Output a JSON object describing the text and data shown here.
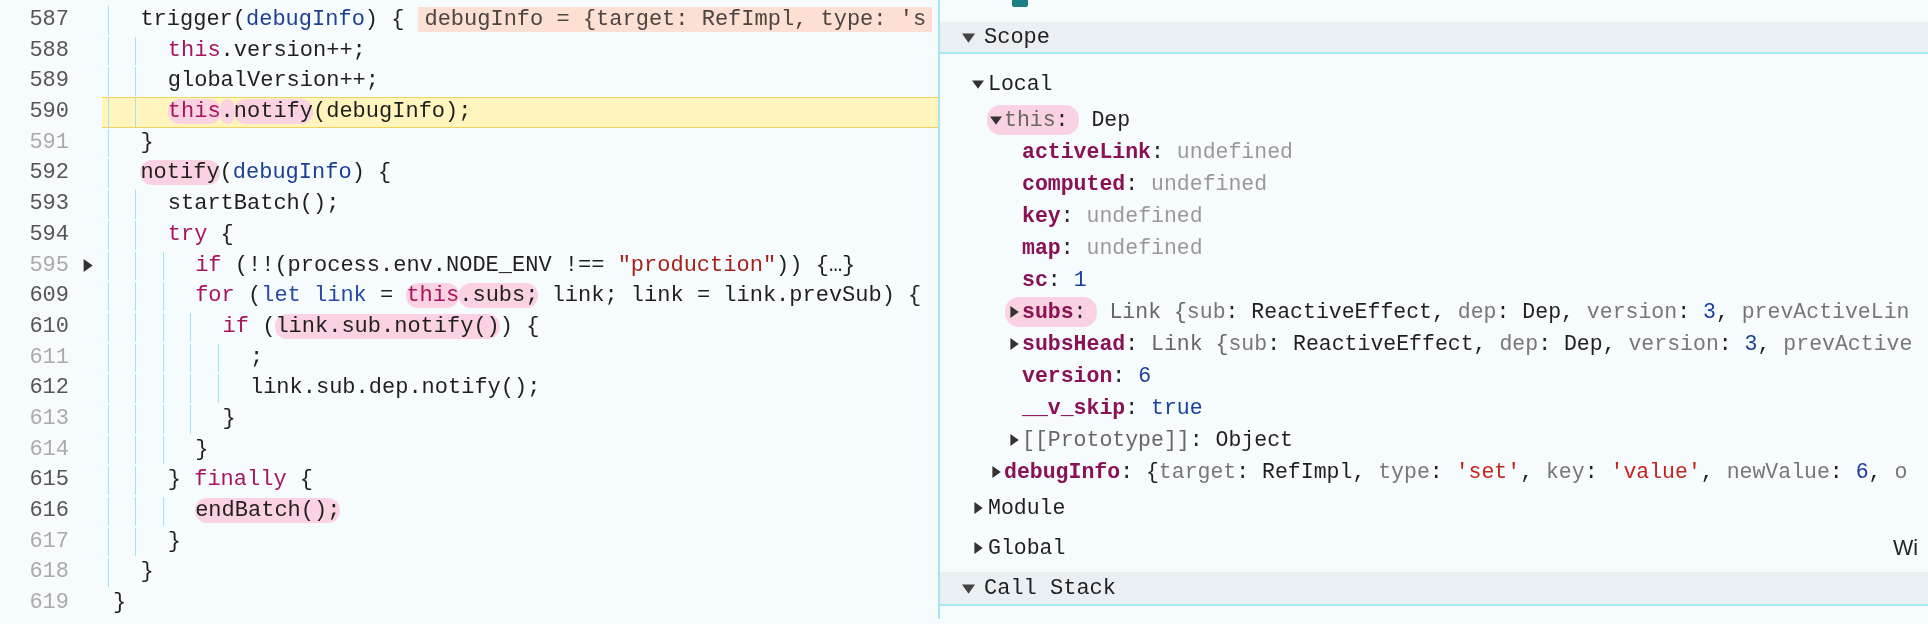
{
  "editor": {
    "lines": [
      {
        "number": "587",
        "breakable": true,
        "current": false,
        "foldable": false,
        "tokens": [
          {
            "text": "  trigger(",
            "kind": "plain",
            "annotated": false
          },
          {
            "text": "debugInfo",
            "kind": "param",
            "annotated": false
          },
          {
            "text": ") {",
            "kind": "plain",
            "annotated": false
          }
        ],
        "inline_value": "debugInfo = {target: RefImpl, type: 's"
      },
      {
        "number": "588",
        "breakable": true,
        "current": false,
        "foldable": false,
        "tokens": [
          {
            "text": "    this",
            "kind": "keyword",
            "annotated": false
          },
          {
            "text": ".version++;",
            "kind": "plain",
            "annotated": false
          }
        ]
      },
      {
        "number": "589",
        "breakable": true,
        "current": false,
        "foldable": false,
        "tokens": [
          {
            "text": "    globalVersion++;",
            "kind": "plain",
            "annotated": false
          }
        ]
      },
      {
        "number": "590",
        "breakable": true,
        "current": true,
        "foldable": false,
        "tokens": [
          {
            "text": "    this",
            "kind": "keyword",
            "annotated": true
          },
          {
            "text": ".",
            "kind": "plain",
            "annotated": true
          },
          {
            "text": "notify",
            "kind": "selection",
            "annotated": true
          },
          {
            "text": "(debugInfo);",
            "kind": "plain",
            "annotated": false
          }
        ]
      },
      {
        "number": "591",
        "breakable": false,
        "current": false,
        "foldable": false,
        "tokens": [
          {
            "text": "  }",
            "kind": "plain",
            "annotated": false
          }
        ]
      },
      {
        "number": "592",
        "breakable": true,
        "current": false,
        "foldable": false,
        "tokens": [
          {
            "text": "  notify",
            "kind": "plain",
            "annotated": true
          },
          {
            "text": "(",
            "kind": "plain",
            "annotated": false
          },
          {
            "text": "debugInfo",
            "kind": "param",
            "annotated": false
          },
          {
            "text": ") {",
            "kind": "plain",
            "annotated": false
          }
        ]
      },
      {
        "number": "593",
        "breakable": true,
        "current": false,
        "foldable": false,
        "tokens": [
          {
            "text": "    startBatch();",
            "kind": "plain",
            "annotated": false
          }
        ]
      },
      {
        "number": "594",
        "breakable": true,
        "current": false,
        "foldable": false,
        "tokens": [
          {
            "text": "    try",
            "kind": "keyword",
            "annotated": false
          },
          {
            "text": " {",
            "kind": "plain",
            "annotated": false
          }
        ]
      },
      {
        "number": "595",
        "breakable": false,
        "current": false,
        "foldable": true,
        "tokens": [
          {
            "text": "      if",
            "kind": "keyword",
            "annotated": false
          },
          {
            "text": " (!!(process.env.NODE_ENV !== ",
            "kind": "plain",
            "annotated": false
          },
          {
            "text": "\"production\"",
            "kind": "string",
            "annotated": false
          },
          {
            "text": ")) {…}",
            "kind": "plain",
            "annotated": false
          }
        ]
      },
      {
        "number": "609",
        "breakable": true,
        "current": false,
        "foldable": false,
        "tokens": [
          {
            "text": "      for",
            "kind": "keyword",
            "annotated": false
          },
          {
            "text": " (",
            "kind": "plain",
            "annotated": false
          },
          {
            "text": "let link",
            "kind": "declaration",
            "annotated": false
          },
          {
            "text": " = ",
            "kind": "plain",
            "annotated": false
          },
          {
            "text": "this",
            "kind": "keyword",
            "annotated": true
          },
          {
            "text": ".subs;",
            "kind": "plain",
            "annotated": true
          },
          {
            "text": " link; link = link.prevSub) {",
            "kind": "plain",
            "annotated": false
          }
        ]
      },
      {
        "number": "610",
        "breakable": true,
        "current": false,
        "foldable": false,
        "tokens": [
          {
            "text": "        if",
            "kind": "keyword",
            "annotated": false
          },
          {
            "text": " (",
            "kind": "plain",
            "annotated": false
          },
          {
            "text": "link.sub.notify()",
            "kind": "plain",
            "annotated": true
          },
          {
            "text": ") {",
            "kind": "plain",
            "annotated": false
          }
        ]
      },
      {
        "number": "611",
        "breakable": false,
        "current": false,
        "foldable": false,
        "tokens": [
          {
            "text": "          ;",
            "kind": "plain",
            "annotated": false
          }
        ]
      },
      {
        "number": "612",
        "breakable": true,
        "current": false,
        "foldable": false,
        "tokens": [
          {
            "text": "          link.sub.dep.notify();",
            "kind": "plain",
            "annotated": false
          }
        ]
      },
      {
        "number": "613",
        "breakable": false,
        "current": false,
        "foldable": false,
        "tokens": [
          {
            "text": "        }",
            "kind": "plain",
            "annotated": false
          }
        ]
      },
      {
        "number": "614",
        "breakable": false,
        "current": false,
        "foldable": false,
        "tokens": [
          {
            "text": "      }",
            "kind": "plain",
            "annotated": false
          }
        ]
      },
      {
        "number": "615",
        "breakable": true,
        "current": false,
        "foldable": false,
        "tokens": [
          {
            "text": "    } ",
            "kind": "plain",
            "annotated": false
          },
          {
            "text": "finally",
            "kind": "keyword",
            "annotated": false
          },
          {
            "text": " {",
            "kind": "plain",
            "annotated": false
          }
        ]
      },
      {
        "number": "616",
        "breakable": true,
        "current": false,
        "foldable": false,
        "tokens": [
          {
            "text": "      endBatch();",
            "kind": "plain",
            "annotated": true
          }
        ]
      },
      {
        "number": "617",
        "breakable": false,
        "current": false,
        "foldable": false,
        "tokens": [
          {
            "text": "    }",
            "kind": "plain",
            "annotated": false
          }
        ]
      },
      {
        "number": "618",
        "breakable": false,
        "current": false,
        "foldable": false,
        "tokens": [
          {
            "text": "  }",
            "kind": "plain",
            "annotated": false
          }
        ]
      },
      {
        "number": "619",
        "breakable": false,
        "current": false,
        "foldable": false,
        "tokens": [
          {
            "text": "}",
            "kind": "plain",
            "annotated": false
          }
        ]
      }
    ]
  },
  "scope": {
    "title": "Scope",
    "expanded": true,
    "items": [
      {
        "name": "Local",
        "kind": "scope",
        "expandable": true,
        "expanded": true,
        "marked": false,
        "children": [
          {
            "name": "this:",
            "kind": "dim",
            "expandable": true,
            "expanded": true,
            "marked": true,
            "value": [
              {
                "text": "Dep",
                "kind": "plain"
              }
            ],
            "children": [
              {
                "name": "activeLink:",
                "kind": "property",
                "expandable": false,
                "marked": false,
                "value": [
                  {
                    "text": "undefined",
                    "kind": "undefined"
                  }
                ]
              },
              {
                "name": "computed:",
                "kind": "property",
                "expandable": false,
                "marked": false,
                "value": [
                  {
                    "text": "undefined",
                    "kind": "undefined"
                  }
                ]
              },
              {
                "name": "key:",
                "kind": "property",
                "expandable": false,
                "marked": false,
                "value": [
                  {
                    "text": "undefined",
                    "kind": "undefined"
                  }
                ]
              },
              {
                "name": "map:",
                "kind": "property",
                "expandable": false,
                "marked": false,
                "value": [
                  {
                    "text": "undefined",
                    "kind": "undefined"
                  }
                ]
              },
              {
                "name": "sc:",
                "kind": "property",
                "expandable": false,
                "marked": false,
                "value": [
                  {
                    "text": "1",
                    "kind": "number"
                  }
                ]
              },
              {
                "name": "subs:",
                "kind": "property",
                "expandable": true,
                "expanded": false,
                "marked": true,
                "value": [
                  {
                    "text": "Link {",
                    "kind": "dim"
                  },
                  {
                    "text": "sub",
                    "kind": "key"
                  },
                  {
                    "text": ": ReactiveEffect, ",
                    "kind": "plain"
                  },
                  {
                    "text": "dep",
                    "kind": "key"
                  },
                  {
                    "text": ": Dep, ",
                    "kind": "plain"
                  },
                  {
                    "text": "version",
                    "kind": "key"
                  },
                  {
                    "text": ": ",
                    "kind": "plain"
                  },
                  {
                    "text": "3",
                    "kind": "number"
                  },
                  {
                    "text": ", ",
                    "kind": "plain"
                  },
                  {
                    "text": "prevActiveLin",
                    "kind": "key"
                  }
                ]
              },
              {
                "name": "subsHead:",
                "kind": "property",
                "expandable": true,
                "expanded": false,
                "marked": false,
                "value": [
                  {
                    "text": "Link {",
                    "kind": "dim"
                  },
                  {
                    "text": "sub",
                    "kind": "key"
                  },
                  {
                    "text": ": ReactiveEffect, ",
                    "kind": "plain"
                  },
                  {
                    "text": "dep",
                    "kind": "key"
                  },
                  {
                    "text": ": Dep, ",
                    "kind": "plain"
                  },
                  {
                    "text": "version",
                    "kind": "key"
                  },
                  {
                    "text": ": ",
                    "kind": "plain"
                  },
                  {
                    "text": "3",
                    "kind": "number"
                  },
                  {
                    "text": ", ",
                    "kind": "plain"
                  },
                  {
                    "text": "prevActive",
                    "kind": "key"
                  }
                ]
              },
              {
                "name": "version:",
                "kind": "property",
                "expandable": false,
                "marked": false,
                "value": [
                  {
                    "text": "6",
                    "kind": "number"
                  }
                ]
              },
              {
                "name": "__v_skip:",
                "kind": "property",
                "expandable": false,
                "marked": false,
                "value": [
                  {
                    "text": "true",
                    "kind": "number"
                  }
                ]
              },
              {
                "name": "[[Prototype]]:",
                "kind": "dim",
                "expandable": true,
                "expanded": false,
                "marked": false,
                "value": [
                  {
                    "text": "Object",
                    "kind": "plain"
                  }
                ]
              }
            ]
          },
          {
            "name": "debugInfo:",
            "kind": "property",
            "expandable": true,
            "expanded": false,
            "marked": false,
            "value": [
              {
                "text": "{",
                "kind": "plain"
              },
              {
                "text": "target",
                "kind": "key"
              },
              {
                "text": ": RefImpl, ",
                "kind": "plain"
              },
              {
                "text": "type",
                "kind": "key"
              },
              {
                "text": ": ",
                "kind": "plain"
              },
              {
                "text": "'set'",
                "kind": "string"
              },
              {
                "text": ", ",
                "kind": "plain"
              },
              {
                "text": "key",
                "kind": "key"
              },
              {
                "text": ": ",
                "kind": "plain"
              },
              {
                "text": "'value'",
                "kind": "string"
              },
              {
                "text": ", ",
                "kind": "plain"
              },
              {
                "text": "newValue",
                "kind": "key"
              },
              {
                "text": ": ",
                "kind": "plain"
              },
              {
                "text": "6",
                "kind": "number"
              },
              {
                "text": ", ",
                "kind": "plain"
              },
              {
                "text": "o",
                "kind": "key"
              }
            ]
          }
        ]
      },
      {
        "name": "Module",
        "kind": "scope",
        "expandable": true,
        "expanded": false,
        "marked": false
      },
      {
        "name": "Global",
        "kind": "scope",
        "expandable": true,
        "expanded": false,
        "marked": false,
        "detail": "Wi"
      }
    ]
  },
  "call_stack": {
    "title": "Call Stack",
    "expanded": true
  }
}
